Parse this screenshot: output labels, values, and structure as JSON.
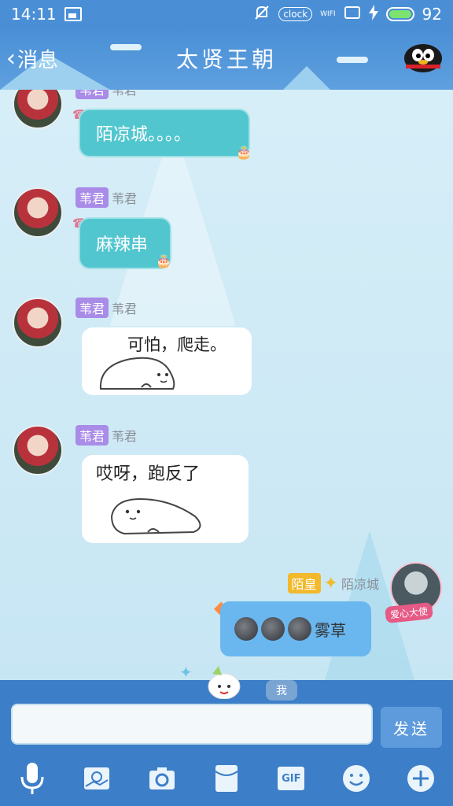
{
  "status_bar": {
    "time": "14:11",
    "clock_label": "clock",
    "wifi_label": "WIFI",
    "battery": "92"
  },
  "header": {
    "back_label": "消息",
    "title": "太贤王朝"
  },
  "messages": [
    {
      "sender_tag": "苇君",
      "sender_name": "苇君",
      "text": "陌凉城。。。。"
    },
    {
      "sender_tag": "苇君",
      "sender_name": "苇君",
      "text": "麻辣串"
    },
    {
      "sender_tag": "苇君",
      "sender_name": "苇君",
      "sticker_text": "可怕，爬走。"
    },
    {
      "sender_tag": "苇君",
      "sender_name": "苇君",
      "sticker_text": "哎呀，跑反了"
    },
    {
      "sender_tag": "陌皇",
      "sender_name": "陌凉城",
      "badge_text": "爱心大使",
      "text": "雾草"
    }
  ],
  "input": {
    "placeholder": "",
    "send_label": "发送",
    "me_label": "我"
  },
  "toolbar": {
    "gif_label": "GIF"
  },
  "colors": {
    "header": "#4a8fd6",
    "tag_purple": "#a98be8",
    "tag_gold": "#f2b92c",
    "bubble_teal": "#52c6cf",
    "bubble_blue": "#6ab7f0"
  }
}
